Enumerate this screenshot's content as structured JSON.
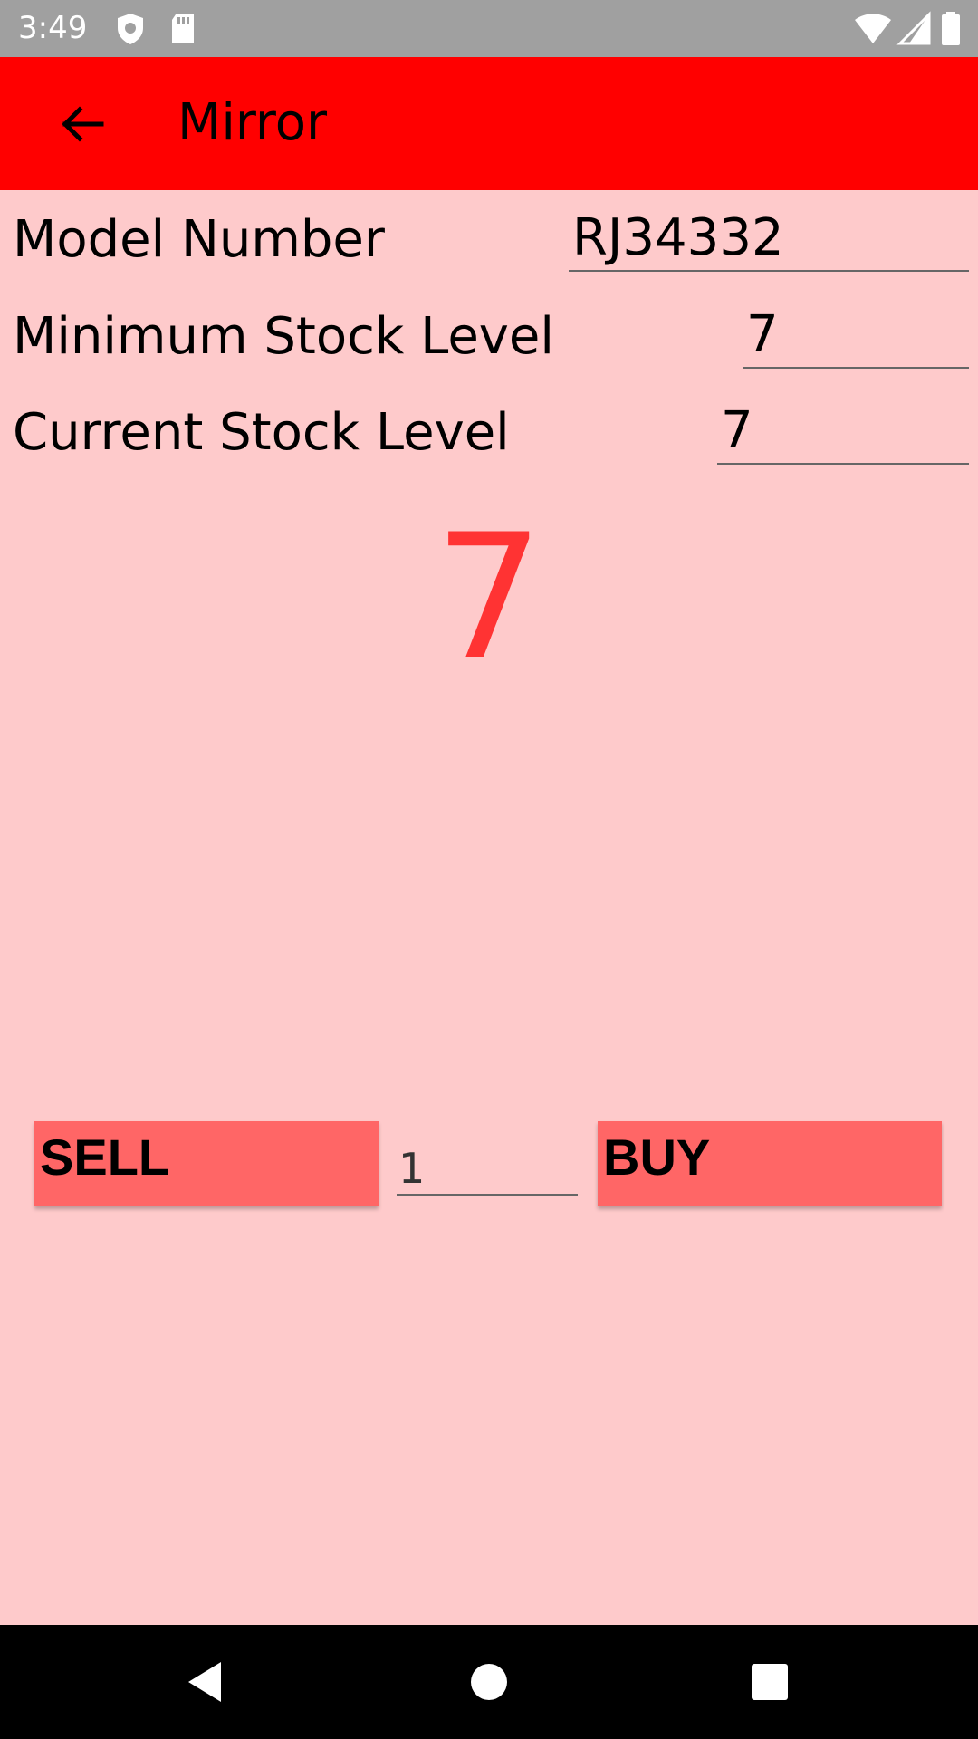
{
  "status_bar": {
    "time": "3:49",
    "icons": [
      "shield-icon",
      "sd-card-icon",
      "wifi-icon",
      "signal-icon",
      "battery-icon"
    ]
  },
  "app_bar": {
    "title": "Mirror",
    "back_icon": "arrow-back-icon",
    "color": "#ff0000"
  },
  "form": {
    "model_number": {
      "label": "Model Number",
      "value": "RJ34332"
    },
    "minimum_stock": {
      "label": "Minimum Stock Level",
      "value": "7"
    },
    "current_stock": {
      "label": "Current Stock Level",
      "value": "7"
    }
  },
  "display": {
    "stock_count": "7",
    "color": "#ff3333"
  },
  "actions": {
    "sell_label": "SELL",
    "quantity": "1",
    "buy_label": "BUY",
    "button_color": "#ff6666"
  },
  "nav_bar": {
    "icons": [
      "back-triangle-icon",
      "home-circle-icon",
      "recents-square-icon"
    ]
  },
  "colors": {
    "background": "#fecacb",
    "status_bar": "#a0a0a0"
  }
}
